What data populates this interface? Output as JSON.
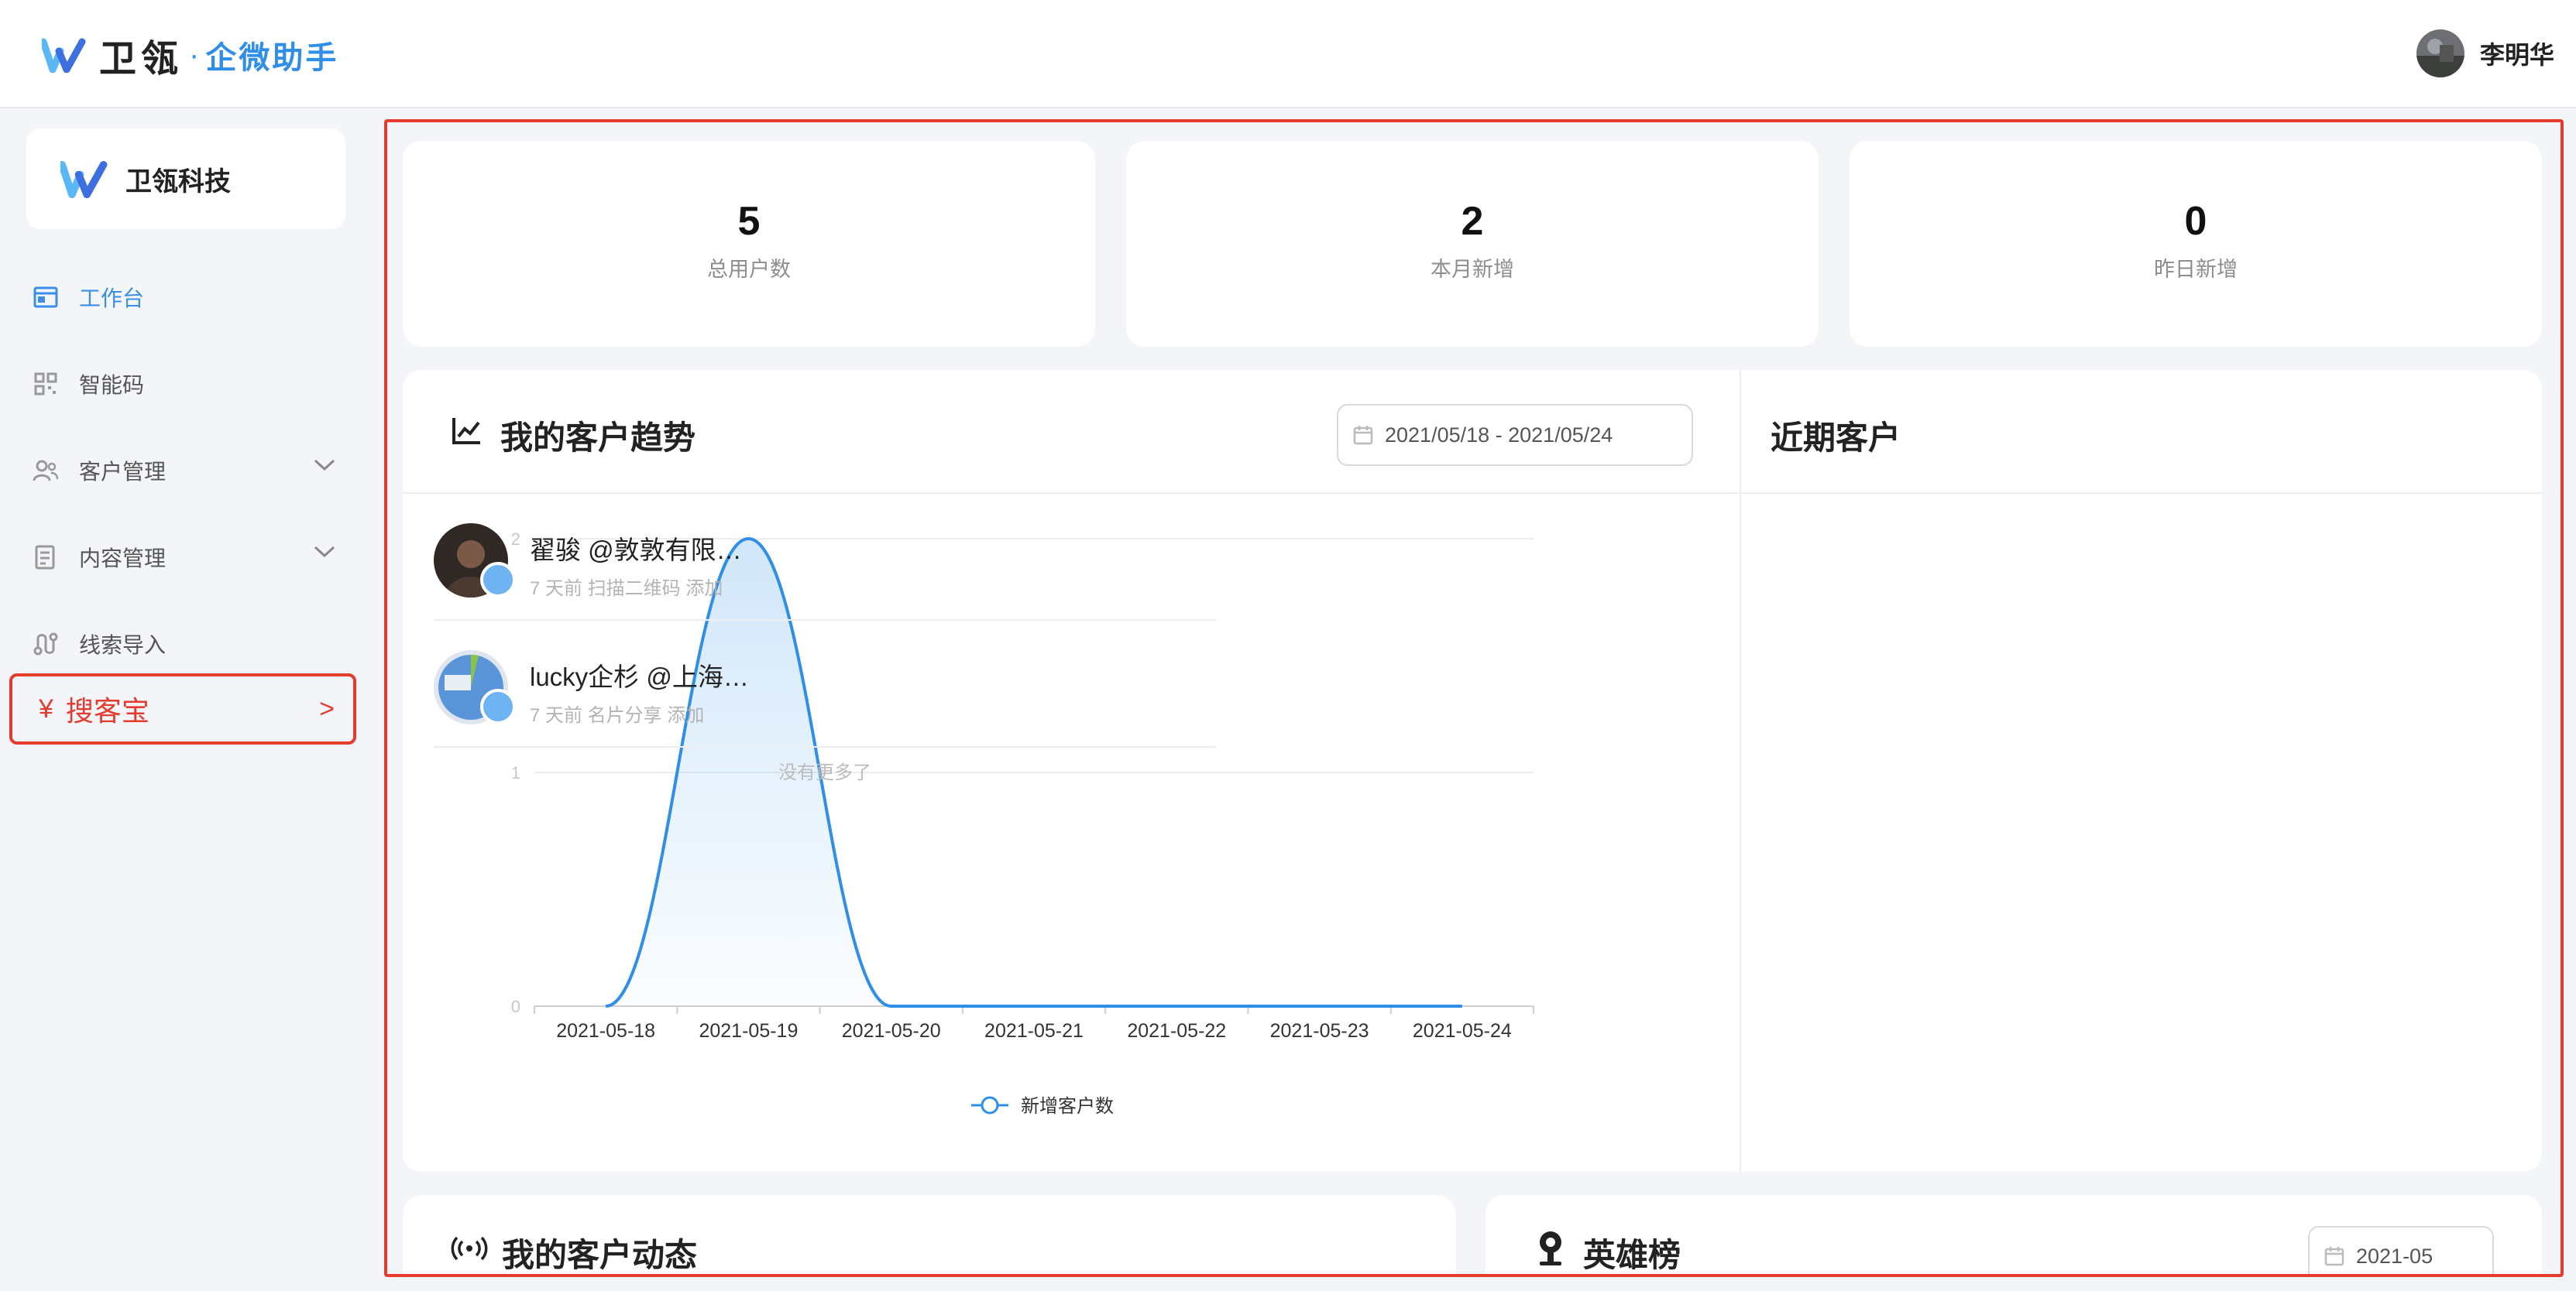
{
  "header": {
    "brand_name": "卫瓴",
    "brand_dot": "·",
    "brand_sub": "企微助手",
    "user_name": "李明华"
  },
  "sidebar": {
    "org_name": "卫瓴科技",
    "items": [
      {
        "label": "工作台",
        "icon": "workbench-icon",
        "active": true
      },
      {
        "label": "智能码",
        "icon": "qrcode-icon",
        "active": false
      },
      {
        "label": "客户管理",
        "icon": "users-icon",
        "active": false,
        "expandable": true
      },
      {
        "label": "内容管理",
        "icon": "document-icon",
        "active": false,
        "expandable": true
      },
      {
        "label": "线索导入",
        "icon": "route-icon",
        "active": false
      }
    ],
    "highlight": {
      "symbol": "¥",
      "label": "搜客宝",
      "arrow": ">"
    }
  },
  "stats": [
    {
      "value": "5",
      "label": "总用户数"
    },
    {
      "value": "2",
      "label": "本月新增"
    },
    {
      "value": "0",
      "label": "昨日新增"
    }
  ],
  "trend": {
    "title": "我的客户趋势",
    "date_range": "2021/05/18 - 2021/05/24"
  },
  "chart_data": {
    "type": "area",
    "x": [
      "2021-05-18",
      "2021-05-19",
      "2021-05-20",
      "2021-05-21",
      "2021-05-22",
      "2021-05-23",
      "2021-05-24"
    ],
    "series": [
      {
        "name": "新增客户数",
        "values": [
          0,
          2,
          0,
          0,
          0,
          0,
          0
        ]
      }
    ],
    "y_ticks": [
      "0",
      "1",
      "2"
    ],
    "ylim": [
      0,
      2
    ],
    "grid": true,
    "legend": "bottom-center",
    "color": "#2f8fe8"
  },
  "recent": {
    "title": "近期客户",
    "customers": [
      {
        "name": "翟骏 @敦敦有限…",
        "meta": "7 天前 扫描二维码 添加"
      },
      {
        "name": "lucky企杉 @上海…",
        "meta": "7 天前 名片分享 添加"
      }
    ],
    "no_more": "没有更多了"
  },
  "bottom": {
    "activity_title": "我的客户动态",
    "rank_title": "英雄榜",
    "rank_date": "2021-05"
  }
}
